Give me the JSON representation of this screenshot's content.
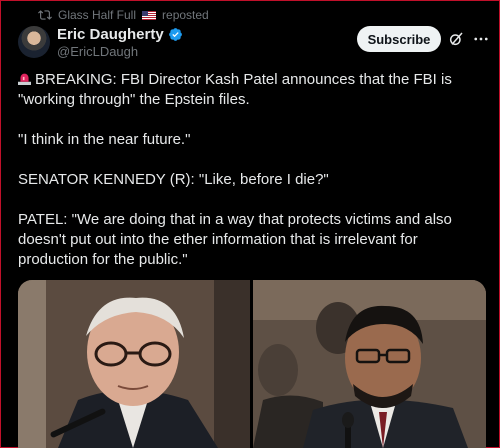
{
  "repost": {
    "icon": "repost-icon",
    "label": "Glass Half Full",
    "suffix": "reposted"
  },
  "author": {
    "name": "Eric Daugherty",
    "handle": "@EricLDaugh",
    "verified": true
  },
  "actions": {
    "subscribe_label": "Subscribe"
  },
  "post": {
    "siren_icon": "siren-emoji",
    "line1": "BREAKING: FBI Director Kash Patel announces that the FBI is \"working through\" the Epstein files.",
    "line2": "\"I think in the near future.\"",
    "line3": "SENATOR KENNEDY (R): \"Like, before I die?\"",
    "line4": "PATEL: \"We are doing that in a way that protects victims and also doesn't put out into the ether information that is irrelevant for production for the public.\""
  },
  "colors": {
    "background": "#000000",
    "text": "#e7e9ea",
    "muted": "#71767b",
    "verified": "#1d9bf0",
    "subscribe_bg": "#eff3f4"
  }
}
